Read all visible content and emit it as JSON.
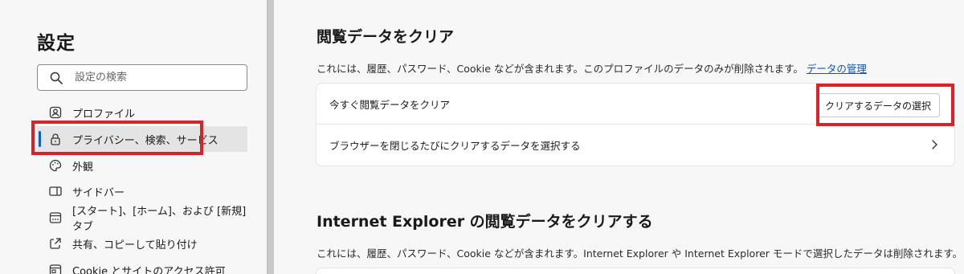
{
  "sidebar": {
    "title": "設定",
    "search_placeholder": "設定の検索",
    "items": [
      {
        "label": "プロファイル",
        "icon": "profile-icon"
      },
      {
        "label": "プライバシー、検索、サービス",
        "icon": "lock-icon",
        "active": true
      },
      {
        "label": "外観",
        "icon": "palette-icon"
      },
      {
        "label": "サイドバー",
        "icon": "sidebar-icon"
      },
      {
        "label": "[スタート]、[ホーム]、および [新規] タブ",
        "icon": "new-tab-icon"
      },
      {
        "label": "共有、コピーして貼り付け",
        "icon": "share-icon"
      },
      {
        "label": "Cookie とサイトのアクセス許可",
        "icon": "cookie-site-icon"
      }
    ]
  },
  "main": {
    "section1": {
      "title": "閲覧データをクリア",
      "description": "これには、履歴、パスワード、Cookie などが含まれます。このプロファイルのデータのみが削除されます。",
      "manage_link": "データの管理",
      "row_clear_now": "今すぐ閲覧データをクリア",
      "choose_button": "クリアするデータの選択",
      "row_on_close": "ブラウザーを閉じるたびにクリアするデータを選択する"
    },
    "section2": {
      "title": "Internet Explorer の閲覧データをクリアする",
      "description": "これには、履歴、パスワード、Cookie などが含まれます。Internet Explorer や Internet Explorer モードで選択したデータは削除されます。"
    }
  },
  "colors": {
    "highlight": "#d9232b",
    "accent": "#0f5fc2",
    "link": "#1058b8"
  }
}
